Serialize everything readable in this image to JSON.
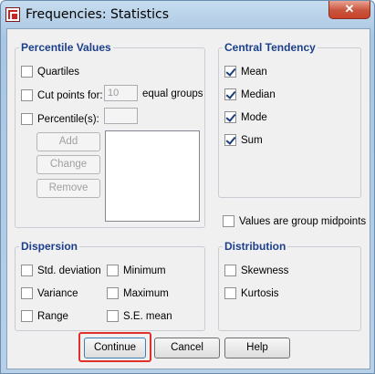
{
  "window": {
    "title": "Frequencies: Statistics",
    "close_glyph": "✕"
  },
  "percentile": {
    "legend": "Percentile Values",
    "quartiles": {
      "label": "Quartiles",
      "checked": false
    },
    "cut_points": {
      "label": "Cut points for:",
      "value": "10",
      "suffix": "equal groups",
      "checked": false
    },
    "percentiles": {
      "label": "Percentile(s):",
      "checked": false
    },
    "buttons": {
      "add": "Add",
      "change": "Change",
      "remove": "Remove"
    }
  },
  "central_tendency": {
    "legend": "Central Tendency",
    "items": [
      {
        "label": "Mean",
        "checked": true
      },
      {
        "label": "Median",
        "checked": true
      },
      {
        "label": "Mode",
        "checked": true
      },
      {
        "label": "Sum",
        "checked": true
      }
    ]
  },
  "group_midpoints": {
    "label": "Values are group midpoints",
    "checked": false
  },
  "dispersion": {
    "legend": "Dispersion",
    "items": [
      {
        "label": "Std. deviation",
        "checked": false
      },
      {
        "label": "Minimum",
        "checked": false
      },
      {
        "label": "Variance",
        "checked": false
      },
      {
        "label": "Maximum",
        "checked": false
      },
      {
        "label": "Range",
        "checked": false
      },
      {
        "label": "S.E. mean",
        "checked": false
      }
    ]
  },
  "distribution": {
    "legend": "Distribution",
    "items": [
      {
        "label": "Skewness",
        "checked": false
      },
      {
        "label": "Kurtosis",
        "checked": false
      }
    ]
  },
  "footer": {
    "continue": "Continue",
    "cancel": "Cancel",
    "help": "Help"
  },
  "colors": {
    "legend": "#1b3f8b",
    "highlight": "#e0302a"
  }
}
